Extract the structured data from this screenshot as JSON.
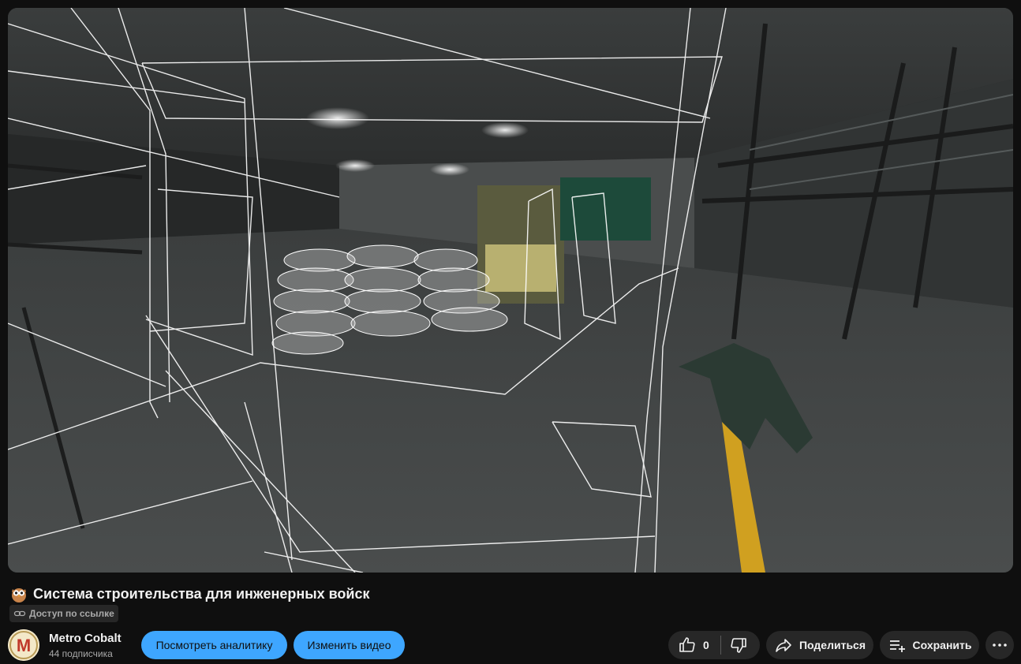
{
  "video": {
    "title_emoji_icon": "owl-emoji-icon",
    "title": "Система строительства для инженерных войск",
    "access_label": "Доступ по ссылке",
    "access_icon": "link-icon"
  },
  "channel": {
    "name": "Metro Cobalt",
    "subscribers": "44 подписчика",
    "avatar_letter": "M",
    "avatar_color": "#c0392b"
  },
  "actions": {
    "analytics_label": "Посмотреть аналитику",
    "edit_label": "Изменить видео",
    "like_count": "0",
    "share_label": "Поделиться",
    "save_label": "Сохранить"
  },
  "colors": {
    "background": "#0f0f0f",
    "accent": "#3ea6ff",
    "chip": "#272727"
  }
}
